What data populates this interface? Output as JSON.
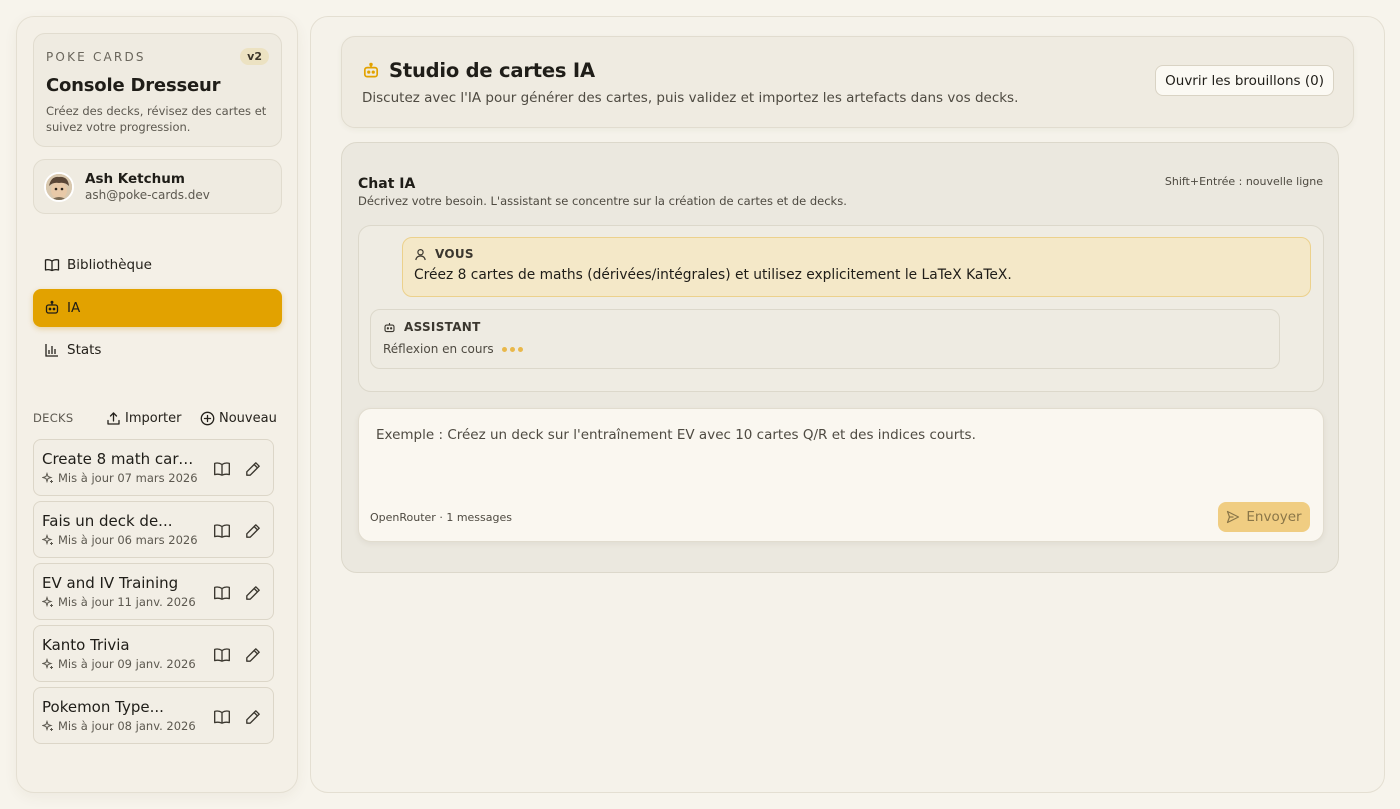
{
  "brand": {
    "eyebrow": "POKE CARDS",
    "badge": "v2",
    "title": "Console Dresseur",
    "description": "Créez des decks, révisez des cartes et suivez votre progression."
  },
  "user": {
    "name": "Ash Ketchum",
    "email": "ash@poke-cards.dev"
  },
  "nav": [
    {
      "label": "Bibliothèque",
      "icon": "book-icon",
      "active": false
    },
    {
      "label": "IA",
      "icon": "robot-icon",
      "active": true
    },
    {
      "label": "Stats",
      "icon": "bar-chart-icon",
      "active": false
    }
  ],
  "decks": {
    "title": "DECKS",
    "import_label": "Importer",
    "new_label": "Nouveau",
    "items": [
      {
        "name": "Create 8 math cards...",
        "updated": "Mis à jour 07 mars 2026"
      },
      {
        "name": "Fais un deck de...",
        "updated": "Mis à jour 06 mars 2026"
      },
      {
        "name": "EV and IV Training",
        "updated": "Mis à jour 11 janv. 2026"
      },
      {
        "name": "Kanto Trivia",
        "updated": "Mis à jour 09 janv. 2026"
      },
      {
        "name": "Pokemon Type...",
        "updated": "Mis à jour 08 janv. 2026"
      }
    ]
  },
  "studio": {
    "title": "Studio de cartes IA",
    "description": "Discutez avec l'IA pour générer des cartes, puis validez et importez les artefacts dans vos decks.",
    "drafts_button": "Ouvrir les brouillons (0)"
  },
  "chat": {
    "title": "Chat IA",
    "subtitle": "Décrivez votre besoin. L'assistant se concentre sur la création de cartes et de decks.",
    "hint": "Shift+Entrée : nouvelle ligne",
    "messages": {
      "user_role": "VOUS",
      "user_text": "Créez 8 cartes de maths (dérivées/intégrales) et utilisez explicitement le LaTeX KaTeX.",
      "assistant_role": "ASSISTANT",
      "assistant_status": "Réflexion en cours"
    },
    "composer": {
      "placeholder": "Exemple : Créez un deck sur l'entraînement EV avec 10 cartes Q/R et des indices courts.",
      "meta": "OpenRouter · 1 messages",
      "send_label": "Envoyer"
    }
  },
  "colors": {
    "accent": "#e2a200",
    "background": "#f7f4ec",
    "user_bubble": "#f4e8c8",
    "send_disabled": "#f0cd82"
  }
}
